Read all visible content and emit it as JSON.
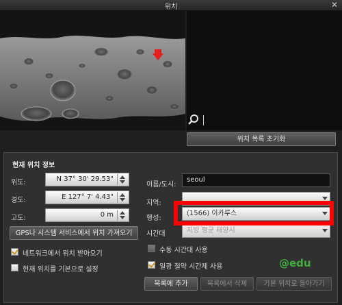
{
  "window": {
    "title": "위치",
    "close_glyph": "✕"
  },
  "list": {
    "reset_button": "위치 목록 초기화"
  },
  "current": {
    "group_title": "현재 위치 정보",
    "latitude_label": "위도:",
    "latitude_value": "N 37° 30' 29.53\"",
    "longitude_label": "경도:",
    "longitude_value": "E 127° 7' 4.43\"",
    "altitude_label": "고도:",
    "altitude_value": "0 m",
    "gps_button": "GPS나 시스템 서비스에서 위치 가져오기",
    "network_checkbox_label": "네트워크에서 위치 받아오기",
    "network_checked": true,
    "default_checkbox_label": "현재 위치를 기본으로 설정",
    "default_checked": false,
    "name_label": "이름/도시:",
    "name_value": "seoul",
    "region_label": "지역:",
    "region_value": "",
    "state_label": "행성:",
    "state_value": "(1566) 이카루스",
    "timezone_label": "시간대",
    "timezone_value": "지방 평균 태양시",
    "manual_tz_label": "수동 시간대 사용",
    "manual_tz_checked": false,
    "dst_label": "일광 절약 시간제 사용",
    "dst_checked": true,
    "add_button": "목록에 추가",
    "delete_button": "목록에서 삭제",
    "return_button": "기본 위치로 돌아가기"
  },
  "watermark": "@edu"
}
